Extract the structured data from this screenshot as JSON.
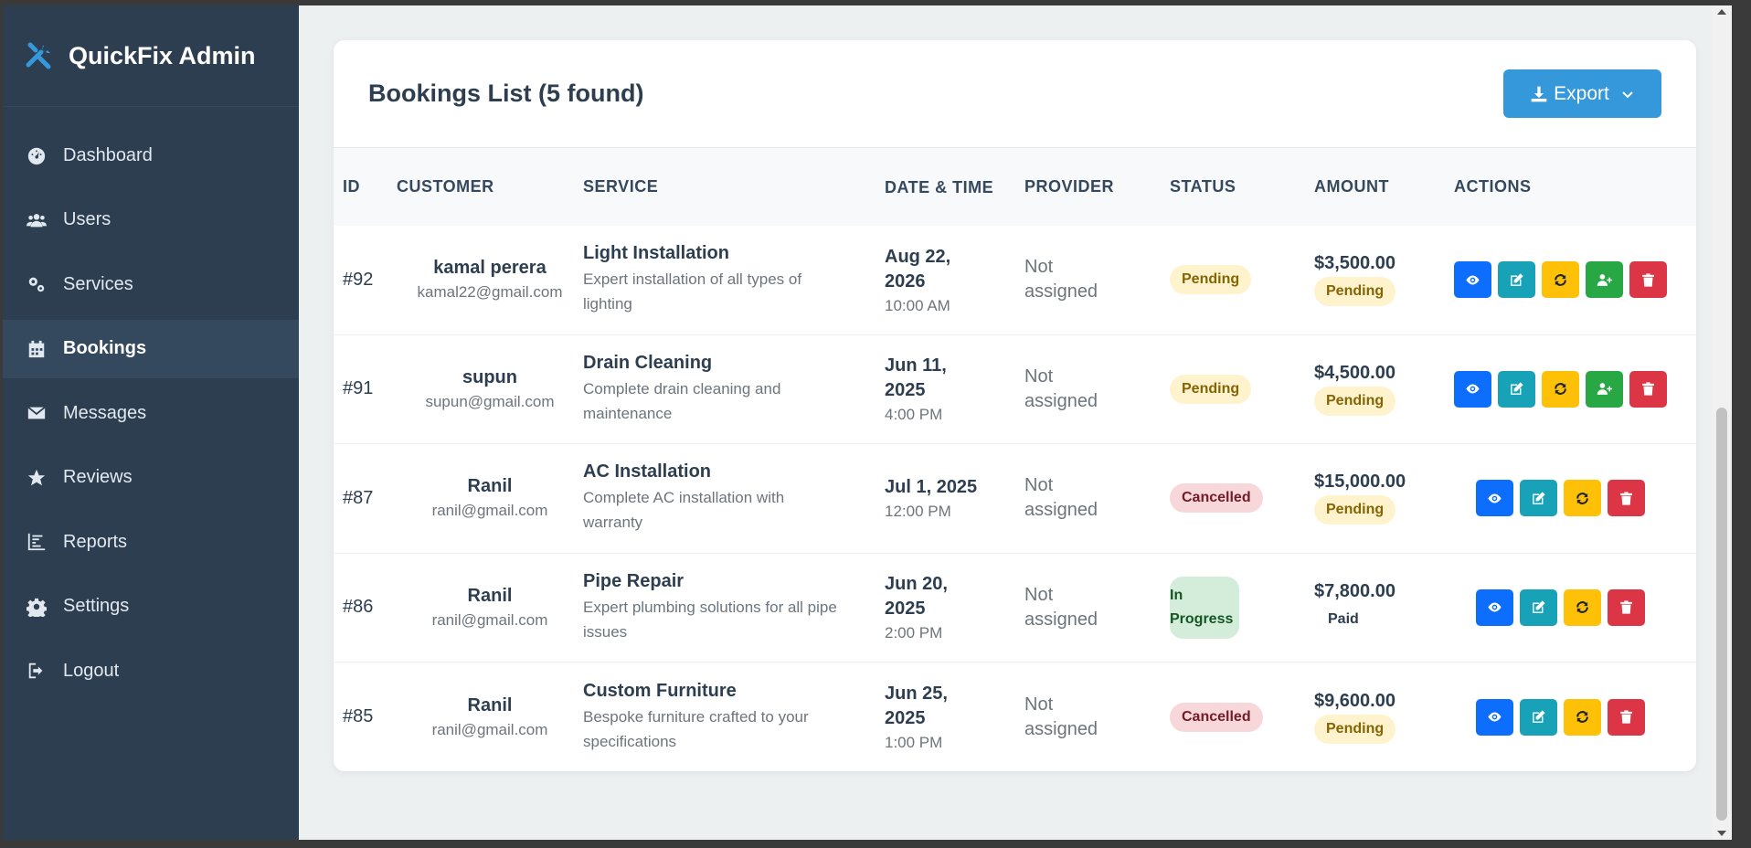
{
  "brand": {
    "name": "QuickFix Admin",
    "icon": "tools-icon",
    "accent": "#3498db"
  },
  "sidebar": {
    "items": [
      {
        "label": "Dashboard",
        "icon": "speedometer-icon"
      },
      {
        "label": "Users",
        "icon": "users-icon"
      },
      {
        "label": "Services",
        "icon": "cogs-icon"
      },
      {
        "label": "Bookings",
        "icon": "calendar-icon",
        "active": true
      },
      {
        "label": "Messages",
        "icon": "envelope-icon"
      },
      {
        "label": "Reviews",
        "icon": "star-icon"
      },
      {
        "label": "Reports",
        "icon": "chart-icon"
      },
      {
        "label": "Settings",
        "icon": "gear-icon"
      },
      {
        "label": "Logout",
        "icon": "logout-icon"
      }
    ]
  },
  "bookings": {
    "title": "Bookings List (5 found)",
    "export_label": "Export",
    "columns": [
      "ID",
      "CUSTOMER",
      "SERVICE",
      "DATE & TIME",
      "PROVIDER",
      "STATUS",
      "AMOUNT",
      "ACTIONS"
    ],
    "rows": [
      {
        "id": "#92",
        "customer_name": "kamal perera",
        "customer_email": "kamal22@gmail.com",
        "service_name": "Light Installation",
        "service_desc": "Expert installation of all types of lighting",
        "date": "Aug 22, 2026",
        "time": "10:00 AM",
        "provider": "Not assigned",
        "status": "Pending",
        "amount": "$3,500.00",
        "payment": "Pending"
      },
      {
        "id": "#91",
        "customer_name": "supun",
        "customer_email": "supun@gmail.com",
        "service_name": "Drain Cleaning",
        "service_desc": "Complete drain cleaning and maintenance",
        "date": "Jun 11, 2025",
        "time": "4:00 PM",
        "provider": "Not assigned",
        "status": "Pending",
        "amount": "$4,500.00",
        "payment": "Pending"
      },
      {
        "id": "#87",
        "customer_name": "Ranil",
        "customer_email": "ranil@gmail.com",
        "service_name": "AC Installation",
        "service_desc": "Complete AC installation with warranty",
        "date": "Jul 1, 2025",
        "time": "12:00 PM",
        "provider": "Not assigned",
        "status": "Cancelled",
        "amount": "$15,000.00",
        "payment": "Pending"
      },
      {
        "id": "#86",
        "customer_name": "Ranil",
        "customer_email": "ranil@gmail.com",
        "service_name": "Pipe Repair",
        "service_desc": "Expert plumbing solutions for all pipe issues",
        "date": "Jun 20, 2025",
        "time": "2:00 PM",
        "provider": "Not assigned",
        "status": "In Progress",
        "amount": "$7,800.00",
        "payment": "Paid"
      },
      {
        "id": "#85",
        "customer_name": "Ranil",
        "customer_email": "ranil@gmail.com",
        "service_name": "Custom Furniture",
        "service_desc": "Bespoke furniture crafted to your specifications",
        "date": "Jun 25, 2025",
        "time": "1:00 PM",
        "provider": "Not assigned",
        "status": "Cancelled",
        "amount": "$9,600.00",
        "payment": "Pending"
      }
    ]
  }
}
